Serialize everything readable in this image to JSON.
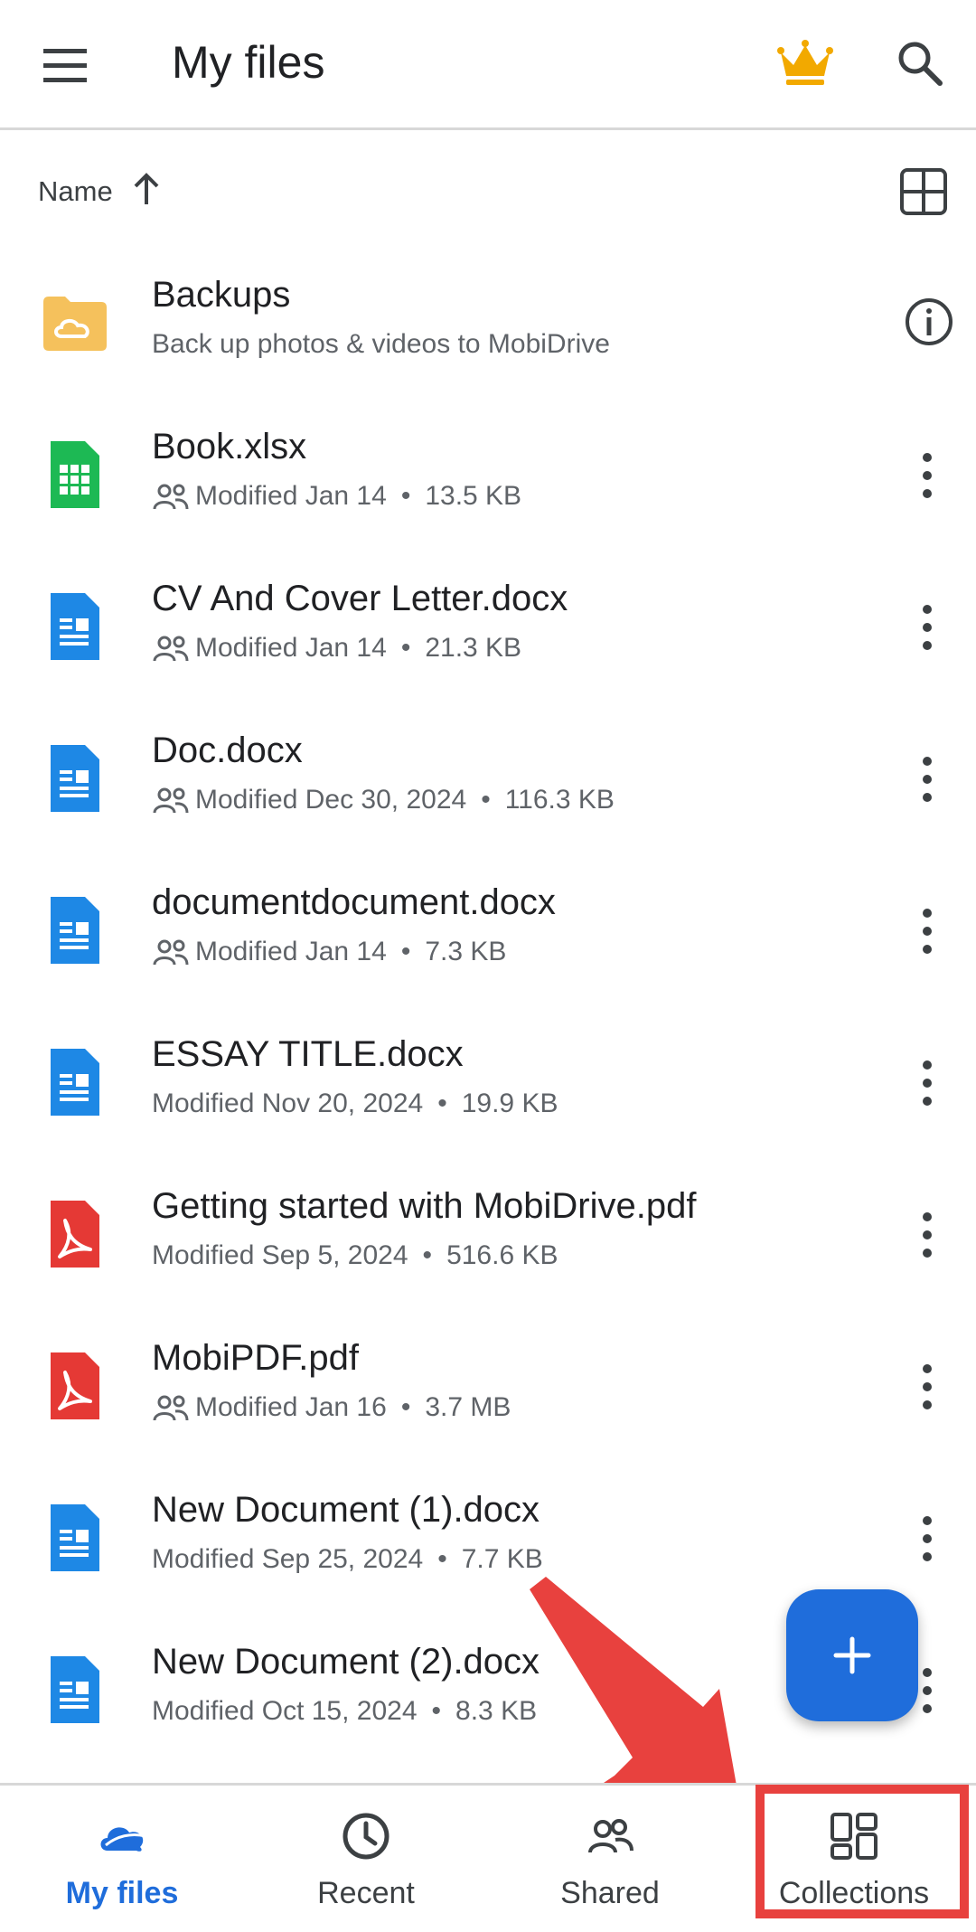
{
  "header": {
    "title": "My files",
    "menu_icon": "hamburger-menu-icon",
    "premium_icon": "crown-icon",
    "search_icon": "search-icon"
  },
  "sort": {
    "label": "Name",
    "direction": "ascending",
    "view_toggle_icon": "grid-view-icon"
  },
  "files": [
    {
      "name": "Backups",
      "meta": "Back up photos & videos to MobiDrive",
      "type": "backup-folder",
      "shared": false,
      "action_icon": "info-icon"
    },
    {
      "name": "Book.xlsx",
      "modified": "Modified Jan 14",
      "size": "13.5 KB",
      "type": "xlsx",
      "shared": true,
      "action_icon": "more-vert-icon"
    },
    {
      "name": "CV And Cover Letter.docx",
      "modified": "Modified Jan 14",
      "size": "21.3 KB",
      "type": "docx",
      "shared": true,
      "action_icon": "more-vert-icon"
    },
    {
      "name": "Doc.docx",
      "modified": "Modified Dec 30, 2024",
      "size": "116.3 KB",
      "type": "docx",
      "shared": true,
      "action_icon": "more-vert-icon"
    },
    {
      "name": "documentdocument.docx",
      "modified": "Modified Jan 14",
      "size": "7.3 KB",
      "type": "docx",
      "shared": true,
      "action_icon": "more-vert-icon"
    },
    {
      "name": "ESSAY TITLE.docx",
      "modified": "Modified Nov 20, 2024",
      "size": "19.9 KB",
      "type": "docx",
      "shared": false,
      "action_icon": "more-vert-icon"
    },
    {
      "name": "Getting started with MobiDrive.pdf",
      "modified": "Modified Sep 5, 2024",
      "size": "516.6 KB",
      "type": "pdf",
      "shared": false,
      "action_icon": "more-vert-icon"
    },
    {
      "name": "MobiPDF.pdf",
      "modified": "Modified Jan 16",
      "size": "3.7 MB",
      "type": "pdf",
      "shared": true,
      "action_icon": "more-vert-icon"
    },
    {
      "name": "New Document (1).docx",
      "modified": "Modified Sep 25, 2024",
      "size": "7.7 KB",
      "type": "docx",
      "shared": false,
      "action_icon": "more-vert-icon"
    },
    {
      "name": "New Document (2).docx",
      "modified": "Modified Oct 15, 2024",
      "size": "8.3 KB",
      "type": "docx",
      "shared": false,
      "action_icon": "more-vert-icon"
    }
  ],
  "separator": "•",
  "fab": {
    "icon": "plus-icon"
  },
  "bottom_nav": [
    {
      "label": "My files",
      "icon": "cloud-icon",
      "active": true
    },
    {
      "label": "Recent",
      "icon": "clock-icon",
      "active": false
    },
    {
      "label": "Shared",
      "icon": "people-icon",
      "active": false
    },
    {
      "label": "Collections",
      "icon": "collections-icon",
      "active": false
    }
  ],
  "colors": {
    "accent": "#1f6ddb",
    "doc_blue": "#1e88e5",
    "sheet_green": "#1db954",
    "pdf_red": "#e53935",
    "folder_yellow": "#f5c15c",
    "crown_gold": "#f2a900",
    "annotation_red": "#e8413e"
  }
}
